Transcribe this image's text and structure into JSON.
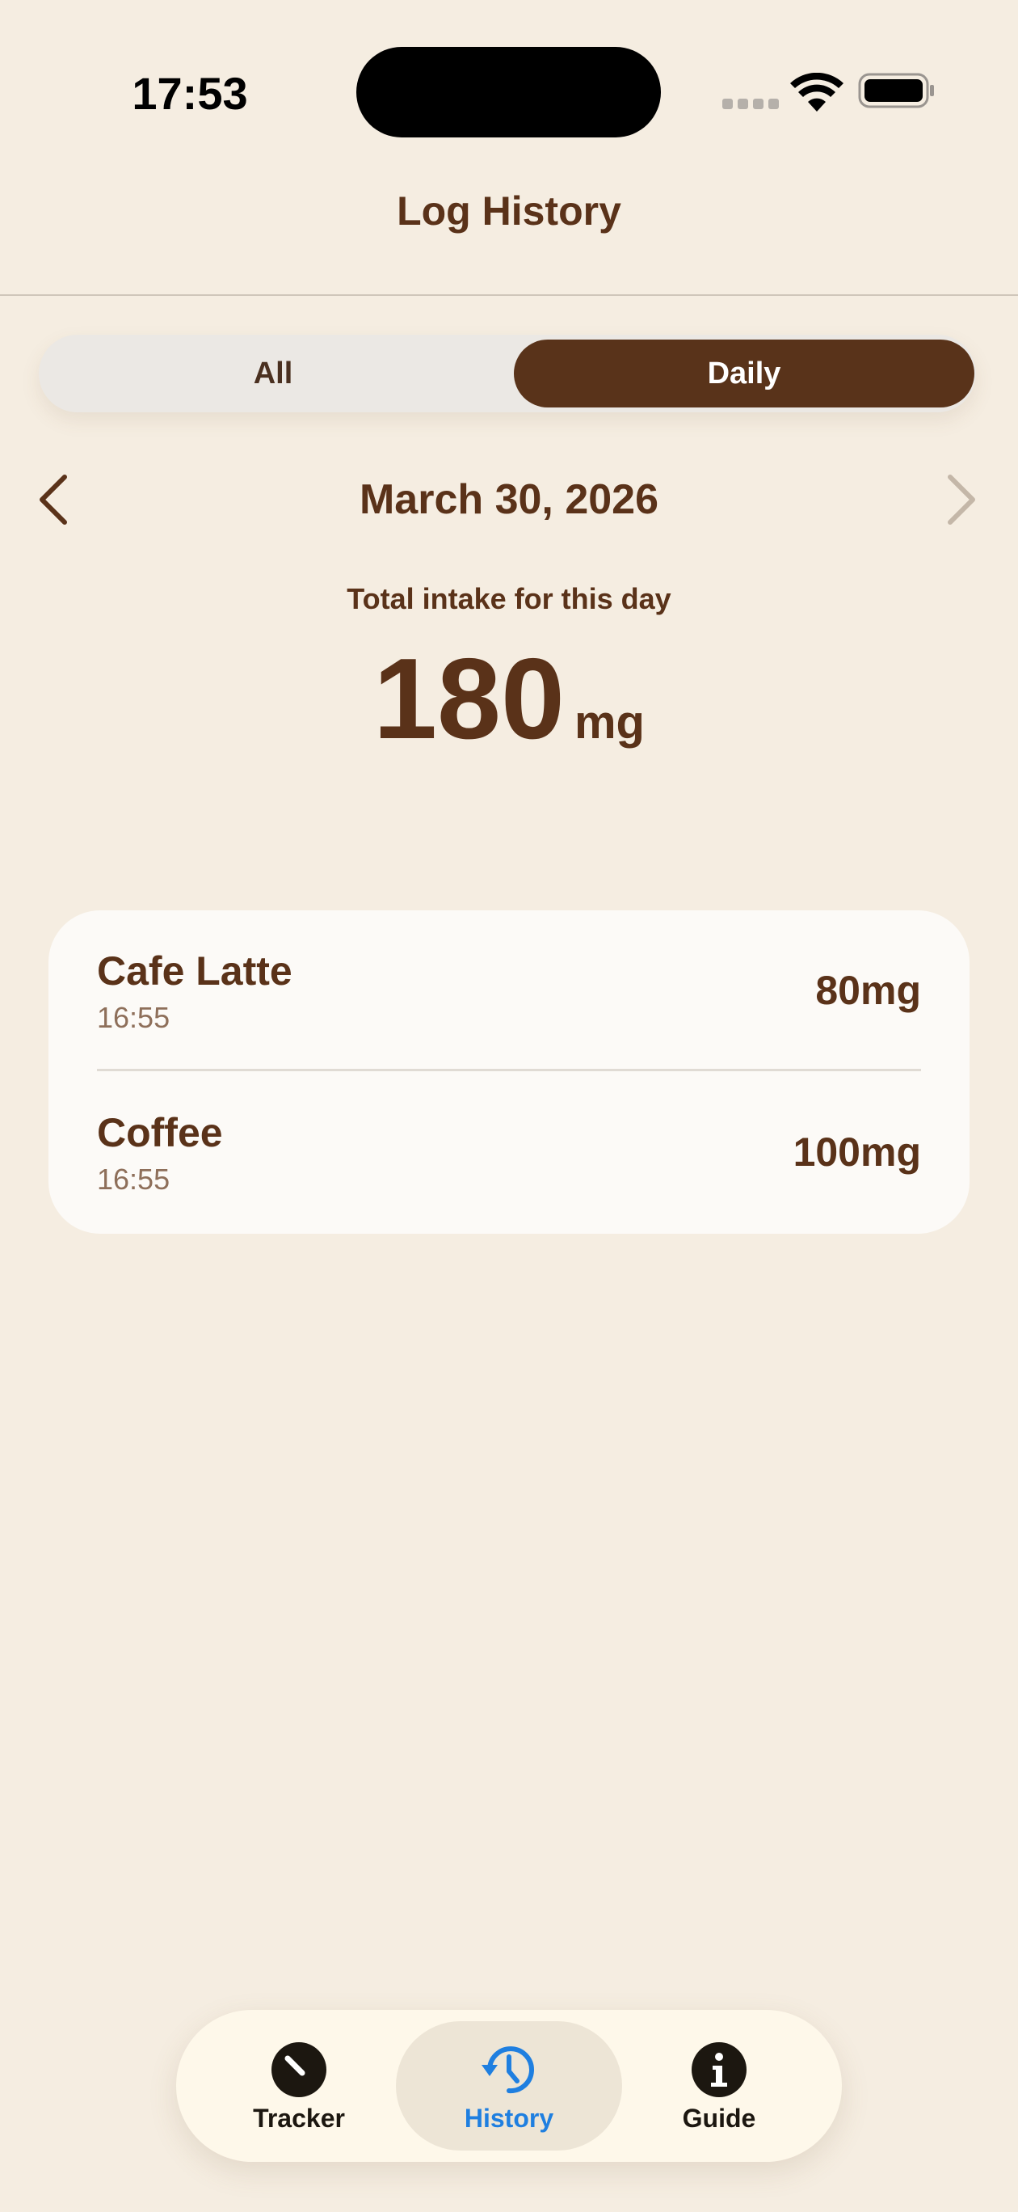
{
  "status_bar": {
    "time": "17:53"
  },
  "header": {
    "title": "Log History"
  },
  "segmented_control": {
    "options": [
      "All",
      "Daily"
    ],
    "selected": "Daily"
  },
  "date_nav": {
    "date": "March 30, 2026",
    "prev_icon": "chevron-left-icon",
    "next_icon": "chevron-right-icon",
    "next_enabled": false
  },
  "summary": {
    "label": "Total intake for this day",
    "total_value": "180",
    "total_unit": "mg"
  },
  "entries": [
    {
      "name": "Cafe Latte",
      "time": "16:55",
      "amount": "80mg"
    },
    {
      "name": "Coffee",
      "time": "16:55",
      "amount": "100mg"
    }
  ],
  "tab_bar": {
    "tabs": [
      {
        "label": "Tracker",
        "icon": "gauge-icon"
      },
      {
        "label": "History",
        "icon": "history-clock-icon"
      },
      {
        "label": "Guide",
        "icon": "info-icon"
      }
    ],
    "selected": "History"
  },
  "colors": {
    "background": "#f5ede1",
    "primary_brown": "#5a3219",
    "segment_selected": "#59331a",
    "tab_active": "#1f7fe0",
    "card": "#fcfaf7"
  }
}
